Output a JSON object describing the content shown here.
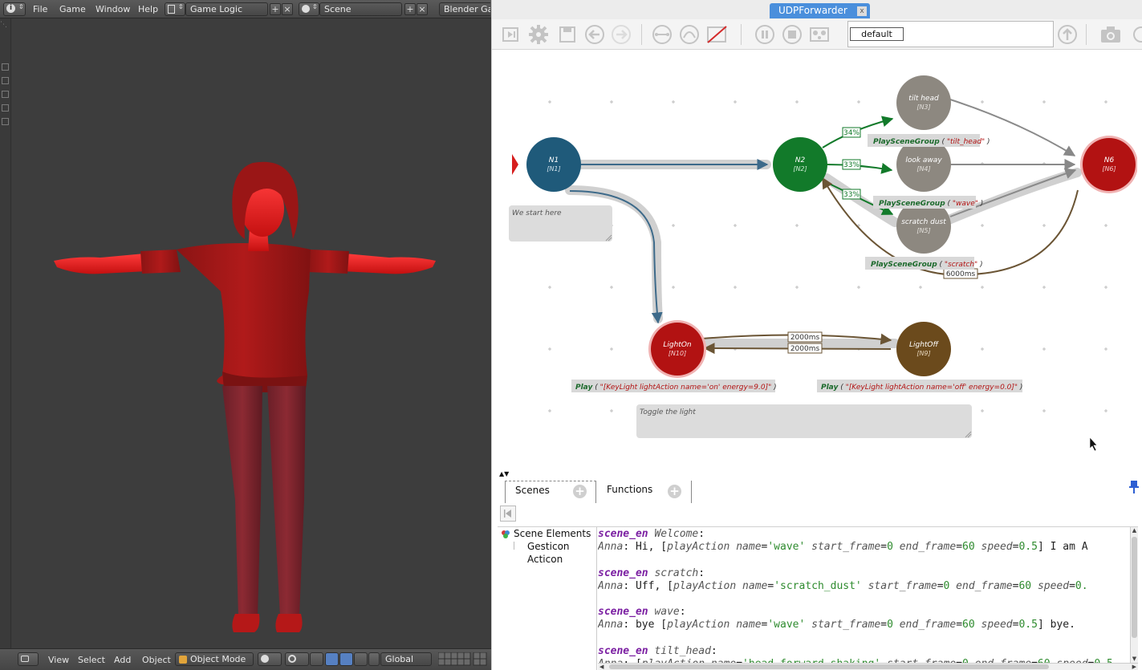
{
  "blender": {
    "menu": [
      "File",
      "Game",
      "Window",
      "Help"
    ],
    "screen_layout": "Game Logic",
    "scene": "Scene",
    "engine": "Blender Gam",
    "bottom_menu": [
      "View",
      "Select",
      "Add",
      "Object"
    ],
    "mode": "Object Mode",
    "orientation": "Global"
  },
  "app": {
    "title": "UDPForwarder",
    "title_close": "x",
    "scene_select_value": "default"
  },
  "graph": {
    "nodes": [
      {
        "name": "N1",
        "id": "[N1]",
        "color": "#1f5a7a"
      },
      {
        "name": "N2",
        "id": "[N2]",
        "color": "#127a2a"
      },
      {
        "name": "tilt head",
        "id": "[N3]",
        "color": "#8d8880"
      },
      {
        "name": "look away",
        "id": "[N4]",
        "color": "#8d8880"
      },
      {
        "name": "scratch dust",
        "id": "[N5]",
        "color": "#8d8880"
      },
      {
        "name": "N6",
        "id": "[N6]",
        "color": "#b21212"
      },
      {
        "name": "LightOn",
        "id": "[N10]",
        "color": "#b21212"
      },
      {
        "name": "LightOff",
        "id": "[N9]",
        "color": "#6b4a1c"
      }
    ],
    "edge_labels": [
      "34%",
      "33%",
      "33%",
      "6000ms",
      "2000ms",
      "2000ms"
    ],
    "commands": [
      {
        "verb": "PlaySceneGroup",
        "arg": "\"tilt_head\""
      },
      {
        "verb": "PlaySceneGroup",
        "arg": "\"wave\""
      },
      {
        "verb": "PlaySceneGroup",
        "arg": "\"scratch\""
      },
      {
        "verb": "Play",
        "arg": "\"[KeyLight lightAction name='on' energy=9.0]\""
      },
      {
        "verb": "Play",
        "arg": "\"[KeyLight lightAction name='off' energy=0.0]\""
      }
    ],
    "comments": [
      "We start here",
      "Toggle the light"
    ]
  },
  "tabs": [
    "Scenes",
    "Functions"
  ],
  "tree": {
    "root": "Scene Elements",
    "children": [
      "Gesticon",
      "Acticon"
    ]
  },
  "code": [
    {
      "kw": "scene_en",
      "name": "Welcome",
      "speaker": "Anna",
      "pre": "Hi, [",
      "action": "playAction",
      "attrs": [
        [
          "name",
          "'wave'"
        ],
        [
          "start_frame",
          "0"
        ],
        [
          "end_frame",
          "60"
        ],
        [
          "speed",
          "0.5"
        ]
      ],
      "post": "] I am A"
    },
    {
      "kw": "scene_en",
      "name": "scratch",
      "speaker": "Anna",
      "pre": "Uff, [",
      "action": "playAction",
      "attrs": [
        [
          "name",
          "'scratch_dust'"
        ],
        [
          "start_frame",
          "0"
        ],
        [
          "end_frame",
          "60"
        ],
        [
          "speed",
          "0."
        ]
      ],
      "post": ""
    },
    {
      "kw": "scene_en",
      "name": "wave",
      "speaker": "Anna",
      "pre": "bye [",
      "action": "playAction",
      "attrs": [
        [
          "name",
          "'wave'"
        ],
        [
          "start_frame",
          "0"
        ],
        [
          "end_frame",
          "60"
        ],
        [
          "speed",
          "0.5"
        ]
      ],
      "post": "] bye."
    },
    {
      "kw": "scene_en",
      "name": "tilt_head",
      "speaker": "Anna",
      "pre": "[",
      "action": "playAction",
      "attrs": [
        [
          "name",
          "'head_forward_shaking'"
        ],
        [
          "start_frame",
          "0"
        ],
        [
          "end_frame",
          "60"
        ],
        [
          "speed",
          "0.5"
        ]
      ],
      "post": ""
    }
  ]
}
